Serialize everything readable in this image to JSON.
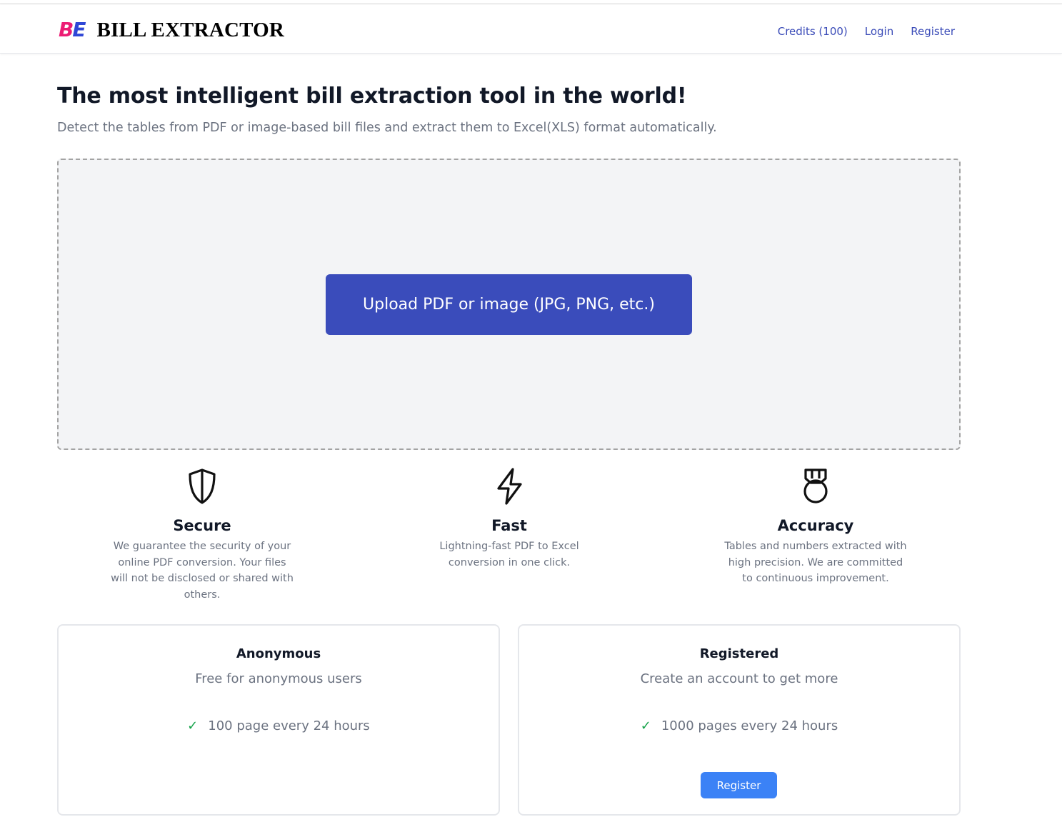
{
  "header": {
    "logo_mark_b": "B",
    "logo_mark_e": "E",
    "brand": "BILL EXTRACTOR",
    "nav": {
      "credits": "Credits (100)",
      "login": "Login",
      "register": "Register"
    }
  },
  "hero": {
    "title": "The most intelligent bill extraction tool in the world!",
    "subtitle": "Detect the tables from PDF or image-based bill files and extract them to Excel(XLS) format automatically."
  },
  "upload": {
    "button_label": "Upload PDF or image (JPG, PNG, etc.)"
  },
  "features": [
    {
      "icon": "shield-icon",
      "title": "Secure",
      "text": "We guarantee the security of your online PDF conversion. Your files will not be disclosed or shared with others."
    },
    {
      "icon": "lightning-icon",
      "title": "Fast",
      "text": "Lightning-fast PDF to Excel conversion in one click."
    },
    {
      "icon": "medal-icon",
      "title": "Accuracy",
      "text": "Tables and numbers extracted with high precision. We are committed to continuous improvement."
    }
  ],
  "plans": [
    {
      "title": "Anonymous",
      "desc": "Free for anonymous users",
      "feature": "100 page every 24 hours"
    },
    {
      "title": "Registered",
      "desc": "Create an account to get more",
      "feature": "1000 pages every 24 hours",
      "button_label": "Register"
    }
  ],
  "colors": {
    "brand_pink": "#ec1c74",
    "brand_blue": "#2f47d6",
    "primary": "#3a4cbb",
    "register_button": "#3b82f6",
    "check": "#16a34a"
  }
}
